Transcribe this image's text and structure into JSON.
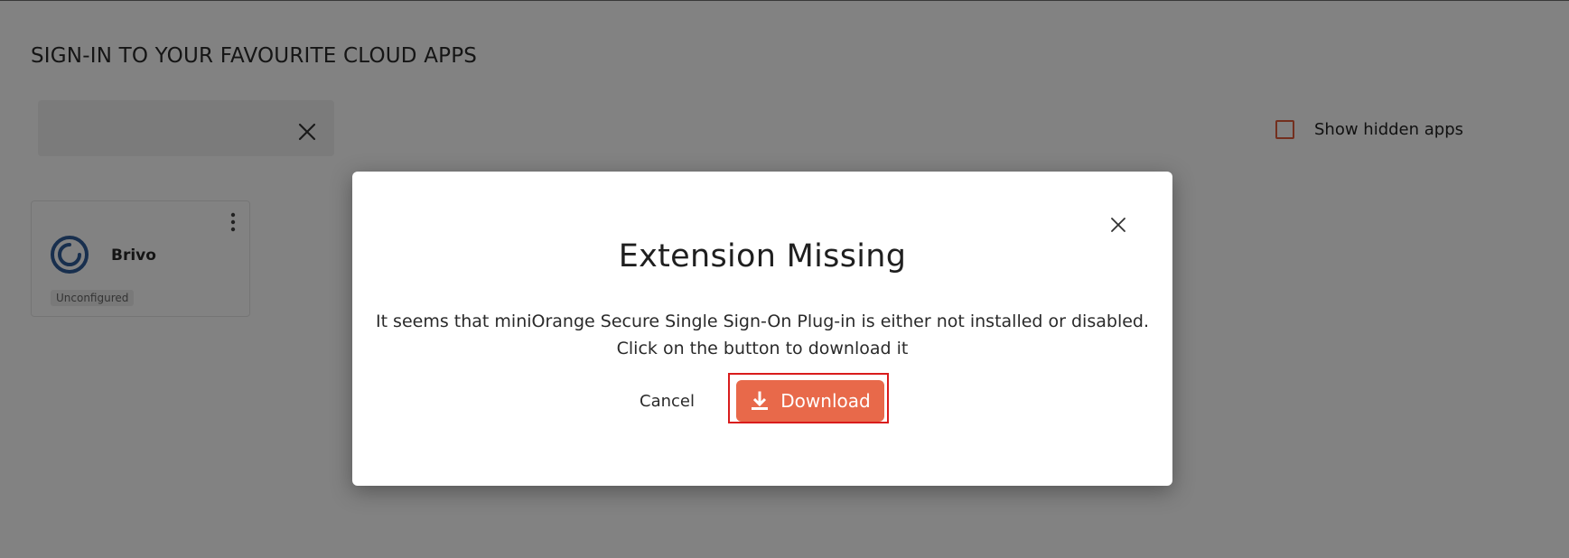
{
  "page": {
    "title": "SIGN-IN TO YOUR FAVOURITE CLOUD APPS",
    "search": {
      "value": "",
      "placeholder": ""
    },
    "show_hidden_label": "Show hidden apps",
    "apps": [
      {
        "name": "Brivo",
        "status": "Unconfigured",
        "logo_icon": "brivo-logo"
      }
    ]
  },
  "modal": {
    "title": "Extension Missing",
    "message_line1": "It seems that miniOrange Secure Single Sign-On Plug-in is either not installed or disabled.",
    "message_line2": "Click on the button to download it",
    "cancel_label": "Cancel",
    "download_label": "Download",
    "download_icon": "download-icon",
    "close_icon": "close-icon"
  },
  "colors": {
    "accent": "#e8694a",
    "highlight_border": "#d91c1c",
    "checkbox_border": "#e25c3b",
    "brivo_blue": "#2f5d9a"
  }
}
